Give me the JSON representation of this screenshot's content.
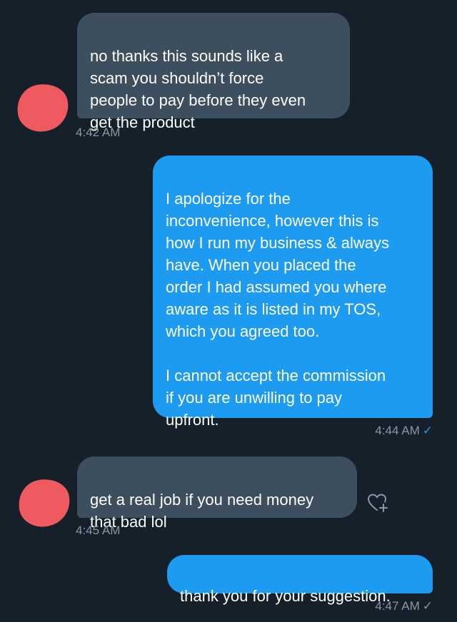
{
  "colors": {
    "background": "#15202b",
    "incoming_bubble": "#3d4f5f",
    "outgoing_bubble": "#1d9bf0",
    "timestamp": "#8899a6",
    "avatar_redaction": "#ee5a5f"
  },
  "messages": [
    {
      "direction": "incoming",
      "text": "no thanks this sounds like a\nscam you shouldn’t force\npeople to pay before they even\nget the product",
      "time": "4:42 AM"
    },
    {
      "direction": "outgoing",
      "text": "I apologize for the\ninconvenience, however this is\nhow I run my business & always\nhave. When you placed the\norder I had assumed you where\naware as it is listed in my TOS,\nwhich you agreed too.\n\nI cannot accept the commission\nif you are unwilling to pay\nupfront.",
      "time": "4:44 AM",
      "status_icon": "check-icon",
      "status_glyph": "✓"
    },
    {
      "direction": "incoming",
      "text": "get a real job if you need money\nthat bad lol",
      "time": "4:45 AM",
      "reaction_icon": "heart-plus-icon"
    },
    {
      "direction": "outgoing",
      "text": "thank you for your suggestion.",
      "time": "4:47 AM",
      "status_icon": "check-icon",
      "status_glyph": "✓"
    }
  ]
}
